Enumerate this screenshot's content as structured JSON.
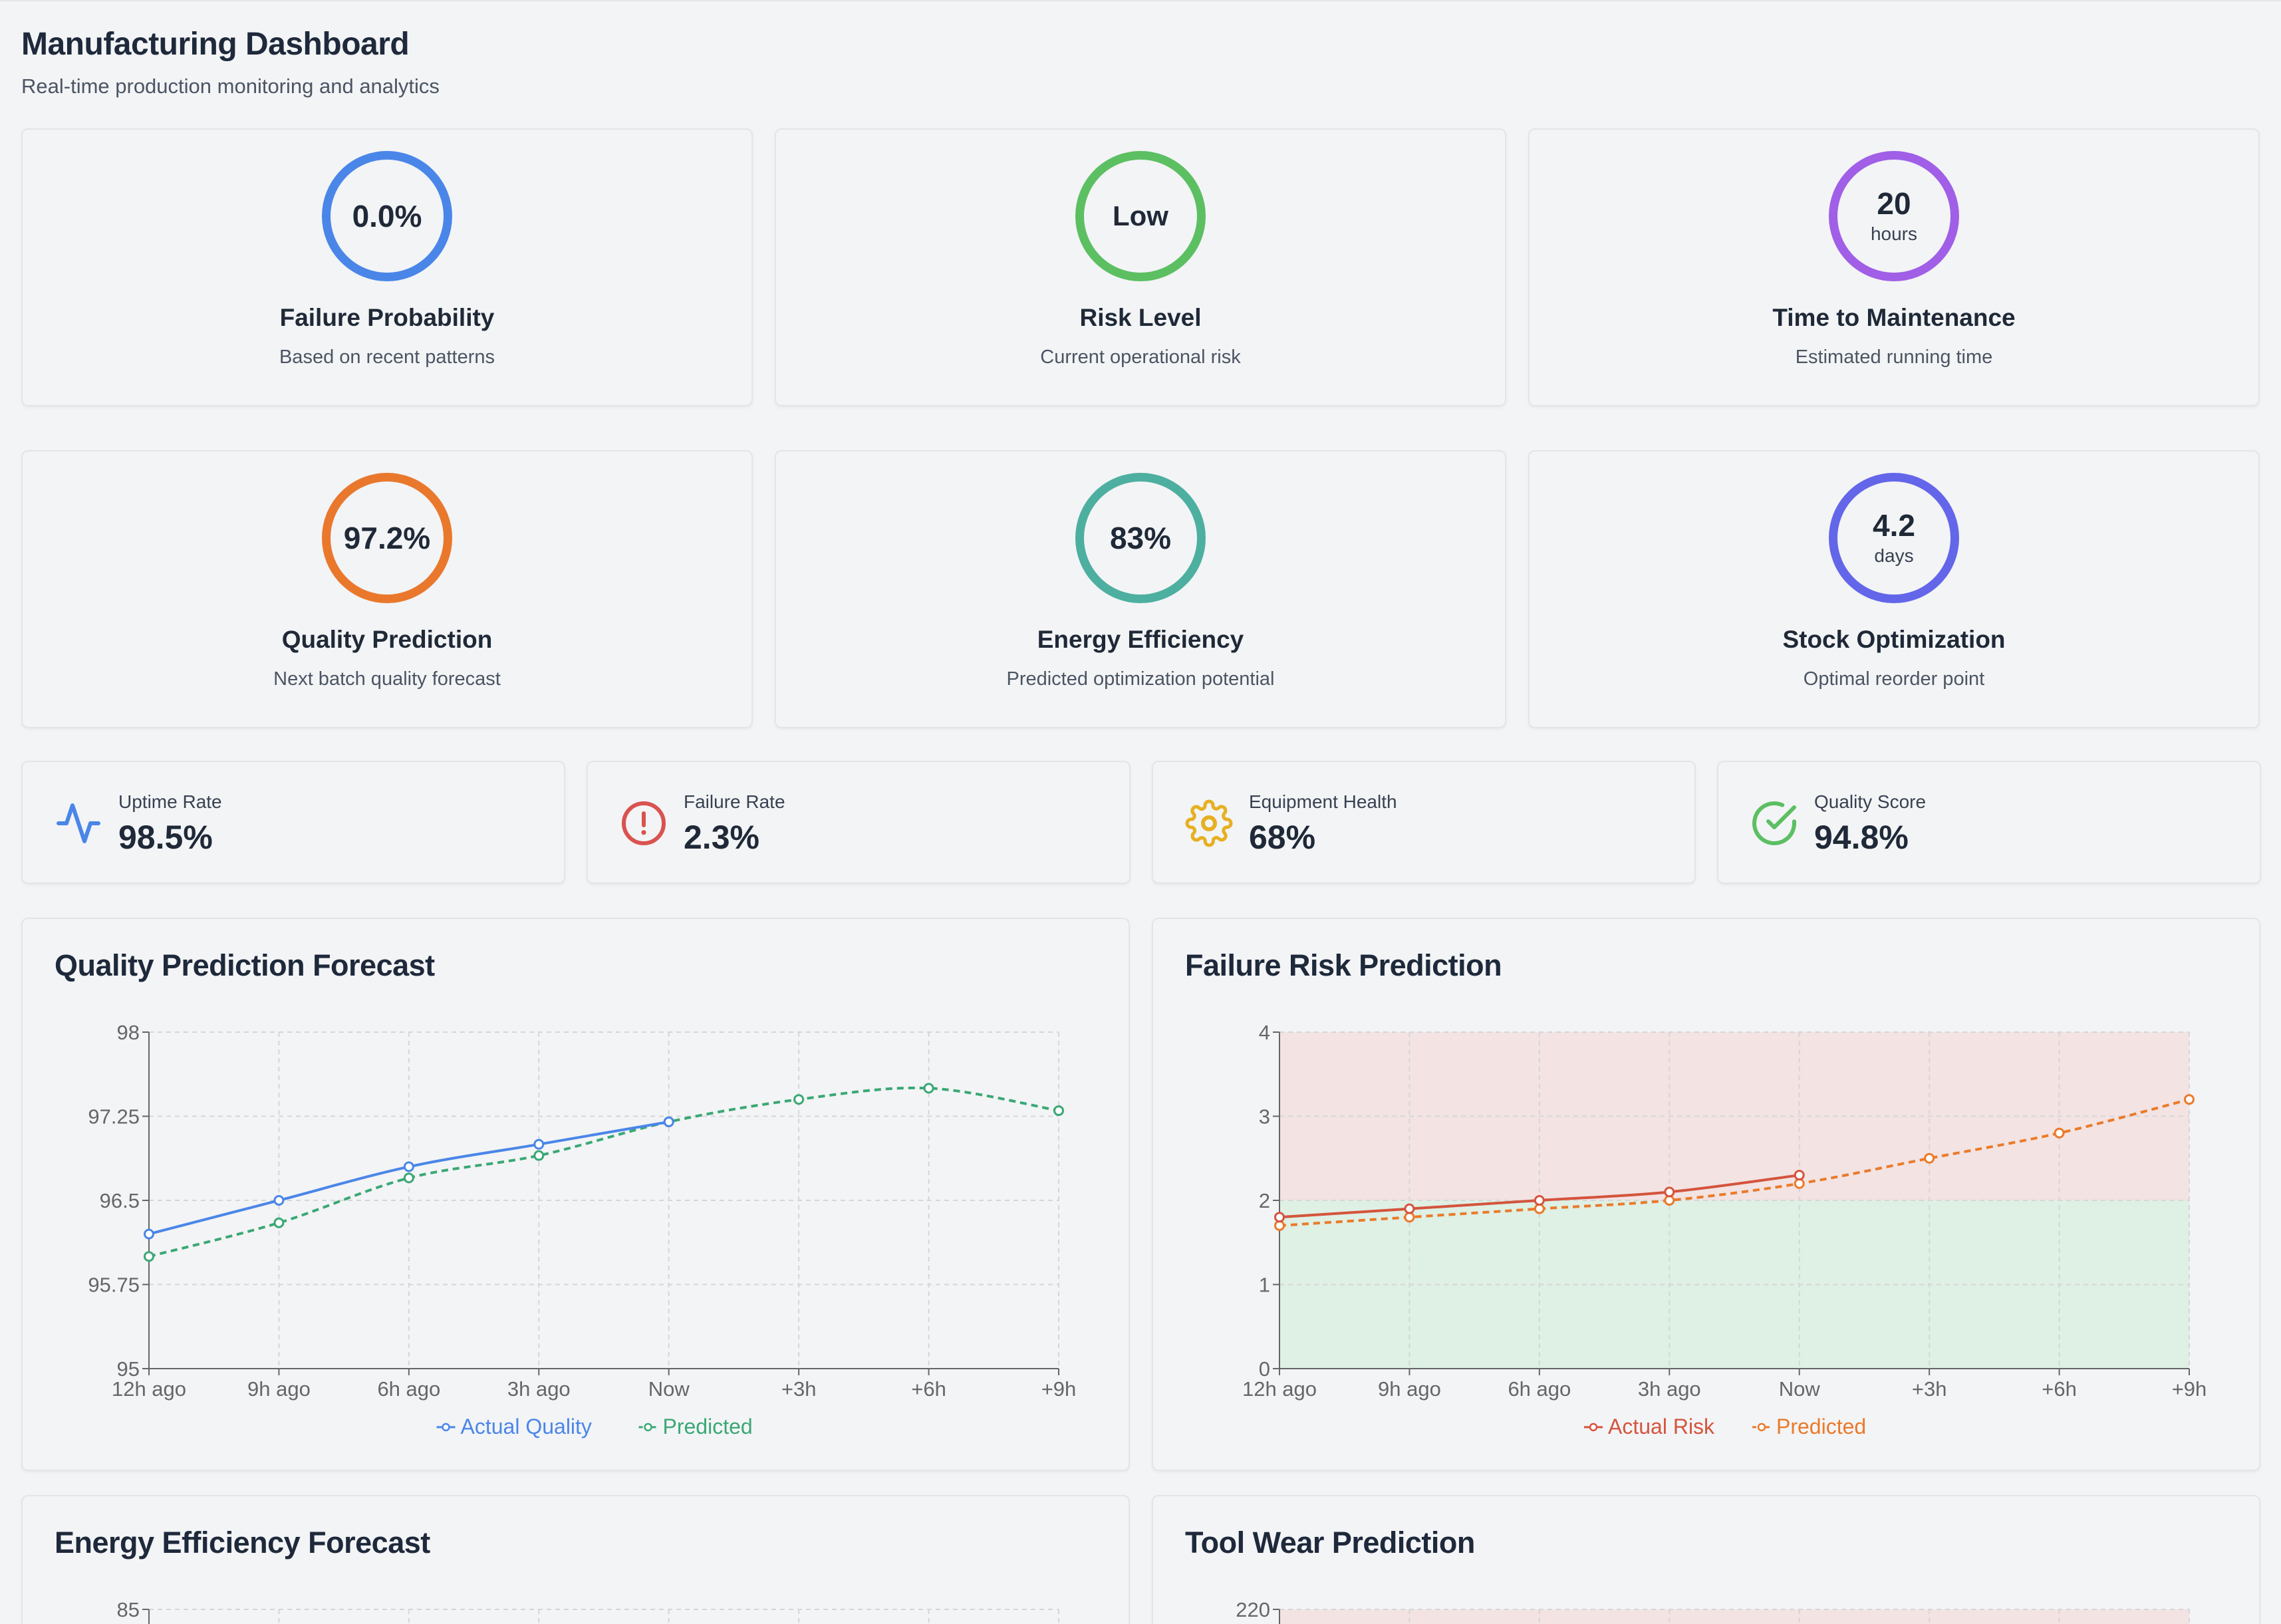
{
  "header": {
    "title": "Manufacturing Dashboard",
    "subtitle": "Real-time production monitoring and analytics"
  },
  "predictions": [
    {
      "value": "0.0%",
      "unit": "",
      "title": "Failure Probability",
      "subtitle": "Based on recent patterns",
      "color": "#4a86e8"
    },
    {
      "value": "Low",
      "unit": "",
      "title": "Risk Level",
      "subtitle": "Current operational risk",
      "color": "#5cbf62"
    },
    {
      "value": "20",
      "unit": "hours",
      "title": "Time to Maintenance",
      "subtitle": "Estimated running time",
      "color": "#a05fe6"
    },
    {
      "value": "97.2%",
      "unit": "",
      "title": "Quality Prediction",
      "subtitle": "Next batch quality forecast",
      "color": "#e9782d"
    },
    {
      "value": "83%",
      "unit": "",
      "title": "Energy Efficiency",
      "subtitle": "Predicted optimization potential",
      "color": "#4daf9f"
    },
    {
      "value": "4.2",
      "unit": "days",
      "title": "Stock Optimization",
      "subtitle": "Optimal reorder point",
      "color": "#6366e9"
    }
  ],
  "stats": [
    {
      "icon": "activity-icon",
      "label": "Uptime Rate",
      "value": "98.5%",
      "color": "#4a86e8"
    },
    {
      "icon": "alert-circle-icon",
      "label": "Failure Rate",
      "value": "2.3%",
      "color": "#d9534f"
    },
    {
      "icon": "gear-icon",
      "label": "Equipment Health",
      "value": "68%",
      "color": "#e6b022"
    },
    {
      "icon": "check-circle-icon",
      "label": "Quality Score",
      "value": "94.8%",
      "color": "#5cbf62"
    }
  ],
  "chart_data": [
    {
      "type": "line",
      "title": "Quality Prediction Forecast",
      "categories": [
        "12h ago",
        "9h ago",
        "6h ago",
        "3h ago",
        "Now",
        "+3h",
        "+6h",
        "+9h"
      ],
      "ylim": [
        95,
        98
      ],
      "yticks": [
        "95",
        "95.75",
        "96.5",
        "97.25",
        "98"
      ],
      "grid": true,
      "legend_position": "bottom",
      "series": [
        {
          "name": "Actual Quality",
          "values": [
            96.2,
            96.5,
            96.8,
            97.0,
            97.2,
            null,
            null,
            null
          ],
          "color": "#4a86e8",
          "dashed": false
        },
        {
          "name": "Predicted",
          "values": [
            96.0,
            96.3,
            96.7,
            96.9,
            97.2,
            97.4,
            97.5,
            97.3
          ],
          "color": "#3aa874",
          "dashed": true
        }
      ]
    },
    {
      "type": "line",
      "title": "Failure Risk Prediction",
      "categories": [
        "12h ago",
        "9h ago",
        "6h ago",
        "3h ago",
        "Now",
        "+3h",
        "+6h",
        "+9h"
      ],
      "ylim": [
        0,
        4
      ],
      "yticks": [
        "0",
        "1",
        "2",
        "3",
        "4"
      ],
      "grid": true,
      "legend_position": "bottom",
      "bands": [
        {
          "from": 0,
          "to": 2,
          "color": "#dff0e4"
        },
        {
          "from": 2,
          "to": 4,
          "color": "#f3e3e2"
        }
      ],
      "series": [
        {
          "name": "Actual Risk",
          "values": [
            1.8,
            1.9,
            2.0,
            2.1,
            2.3,
            null,
            null,
            null
          ],
          "color": "#d4543d",
          "dashed": false
        },
        {
          "name": "Predicted",
          "values": [
            1.7,
            1.8,
            1.9,
            2.0,
            2.2,
            2.5,
            2.8,
            3.2
          ],
          "color": "#ea7a2a",
          "dashed": true
        }
      ]
    }
  ],
  "lower_charts": [
    {
      "title": "Energy Efficiency Forecast",
      "ytop": "85"
    },
    {
      "title": "Tool Wear Prediction",
      "ytop": "220"
    }
  ]
}
